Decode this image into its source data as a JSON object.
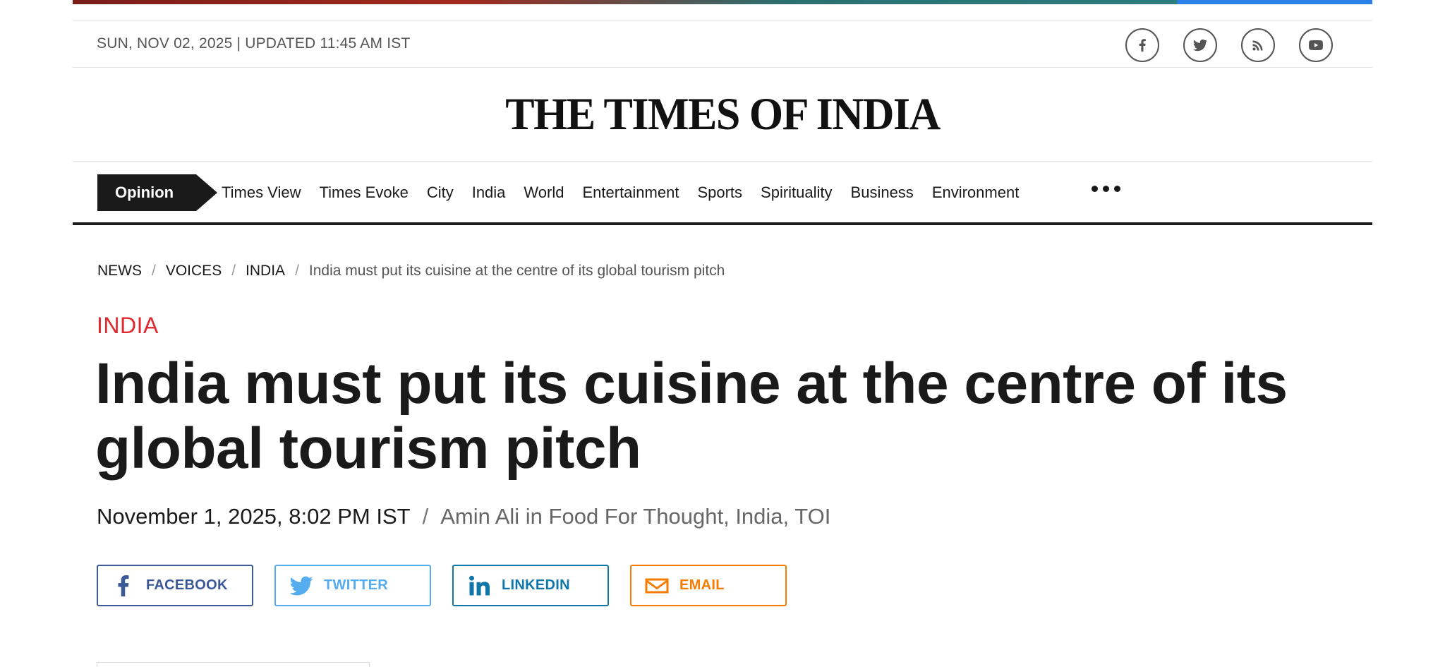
{
  "header": {
    "dateline": "SUN, NOV 02, 2025 | UPDATED 11:45 AM IST",
    "social_icons": [
      "facebook-icon",
      "twitter-icon",
      "rss-icon",
      "youtube-icon"
    ]
  },
  "masthead": {
    "title": "THE TIMES OF INDIA"
  },
  "nav": {
    "active": "Opinion",
    "items": [
      "Times View",
      "Times Evoke",
      "City",
      "India",
      "World",
      "Entertainment",
      "Sports",
      "Spirituality",
      "Business",
      "Environment"
    ]
  },
  "breadcrumb": {
    "items": [
      "NEWS",
      "VOICES",
      "INDIA"
    ],
    "current": "India must put its cuisine at the centre of its global tourism pitch"
  },
  "article": {
    "section": "INDIA",
    "headline": "India must put its cuisine at the centre of its global tourism pitch",
    "date": "November 1, 2025, 8:02 PM IST",
    "byline": "Amin Ali in Food For Thought, India, TOI"
  },
  "share": {
    "facebook": "FACEBOOK",
    "twitter": "TWITTER",
    "linkedin": "LINKEDIN",
    "email": "EMAIL"
  },
  "colors": {
    "section_red": "#e0292f",
    "facebook": "#3b5998",
    "twitter": "#55acee",
    "linkedin": "#0e76a8",
    "email": "#f57c00"
  }
}
